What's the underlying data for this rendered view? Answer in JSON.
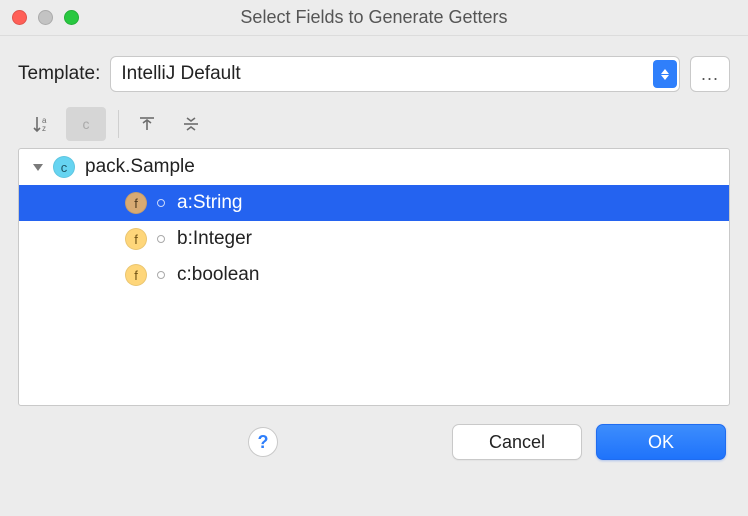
{
  "dialog": {
    "title": "Select Fields to Generate Getters"
  },
  "template": {
    "label": "Template:",
    "value": "IntelliJ Default",
    "more": "..."
  },
  "tree": {
    "root": {
      "label": "pack.Sample",
      "icon_letter": "c"
    },
    "fields": [
      {
        "icon_letter": "f",
        "label": "a:String",
        "selected": true,
        "icon_tone": "brown"
      },
      {
        "icon_letter": "f",
        "label": "b:Integer",
        "selected": false,
        "icon_tone": ""
      },
      {
        "icon_letter": "f",
        "label": "c:boolean",
        "selected": false,
        "icon_tone": ""
      }
    ]
  },
  "buttons": {
    "help": "?",
    "cancel": "Cancel",
    "ok": "OK"
  }
}
